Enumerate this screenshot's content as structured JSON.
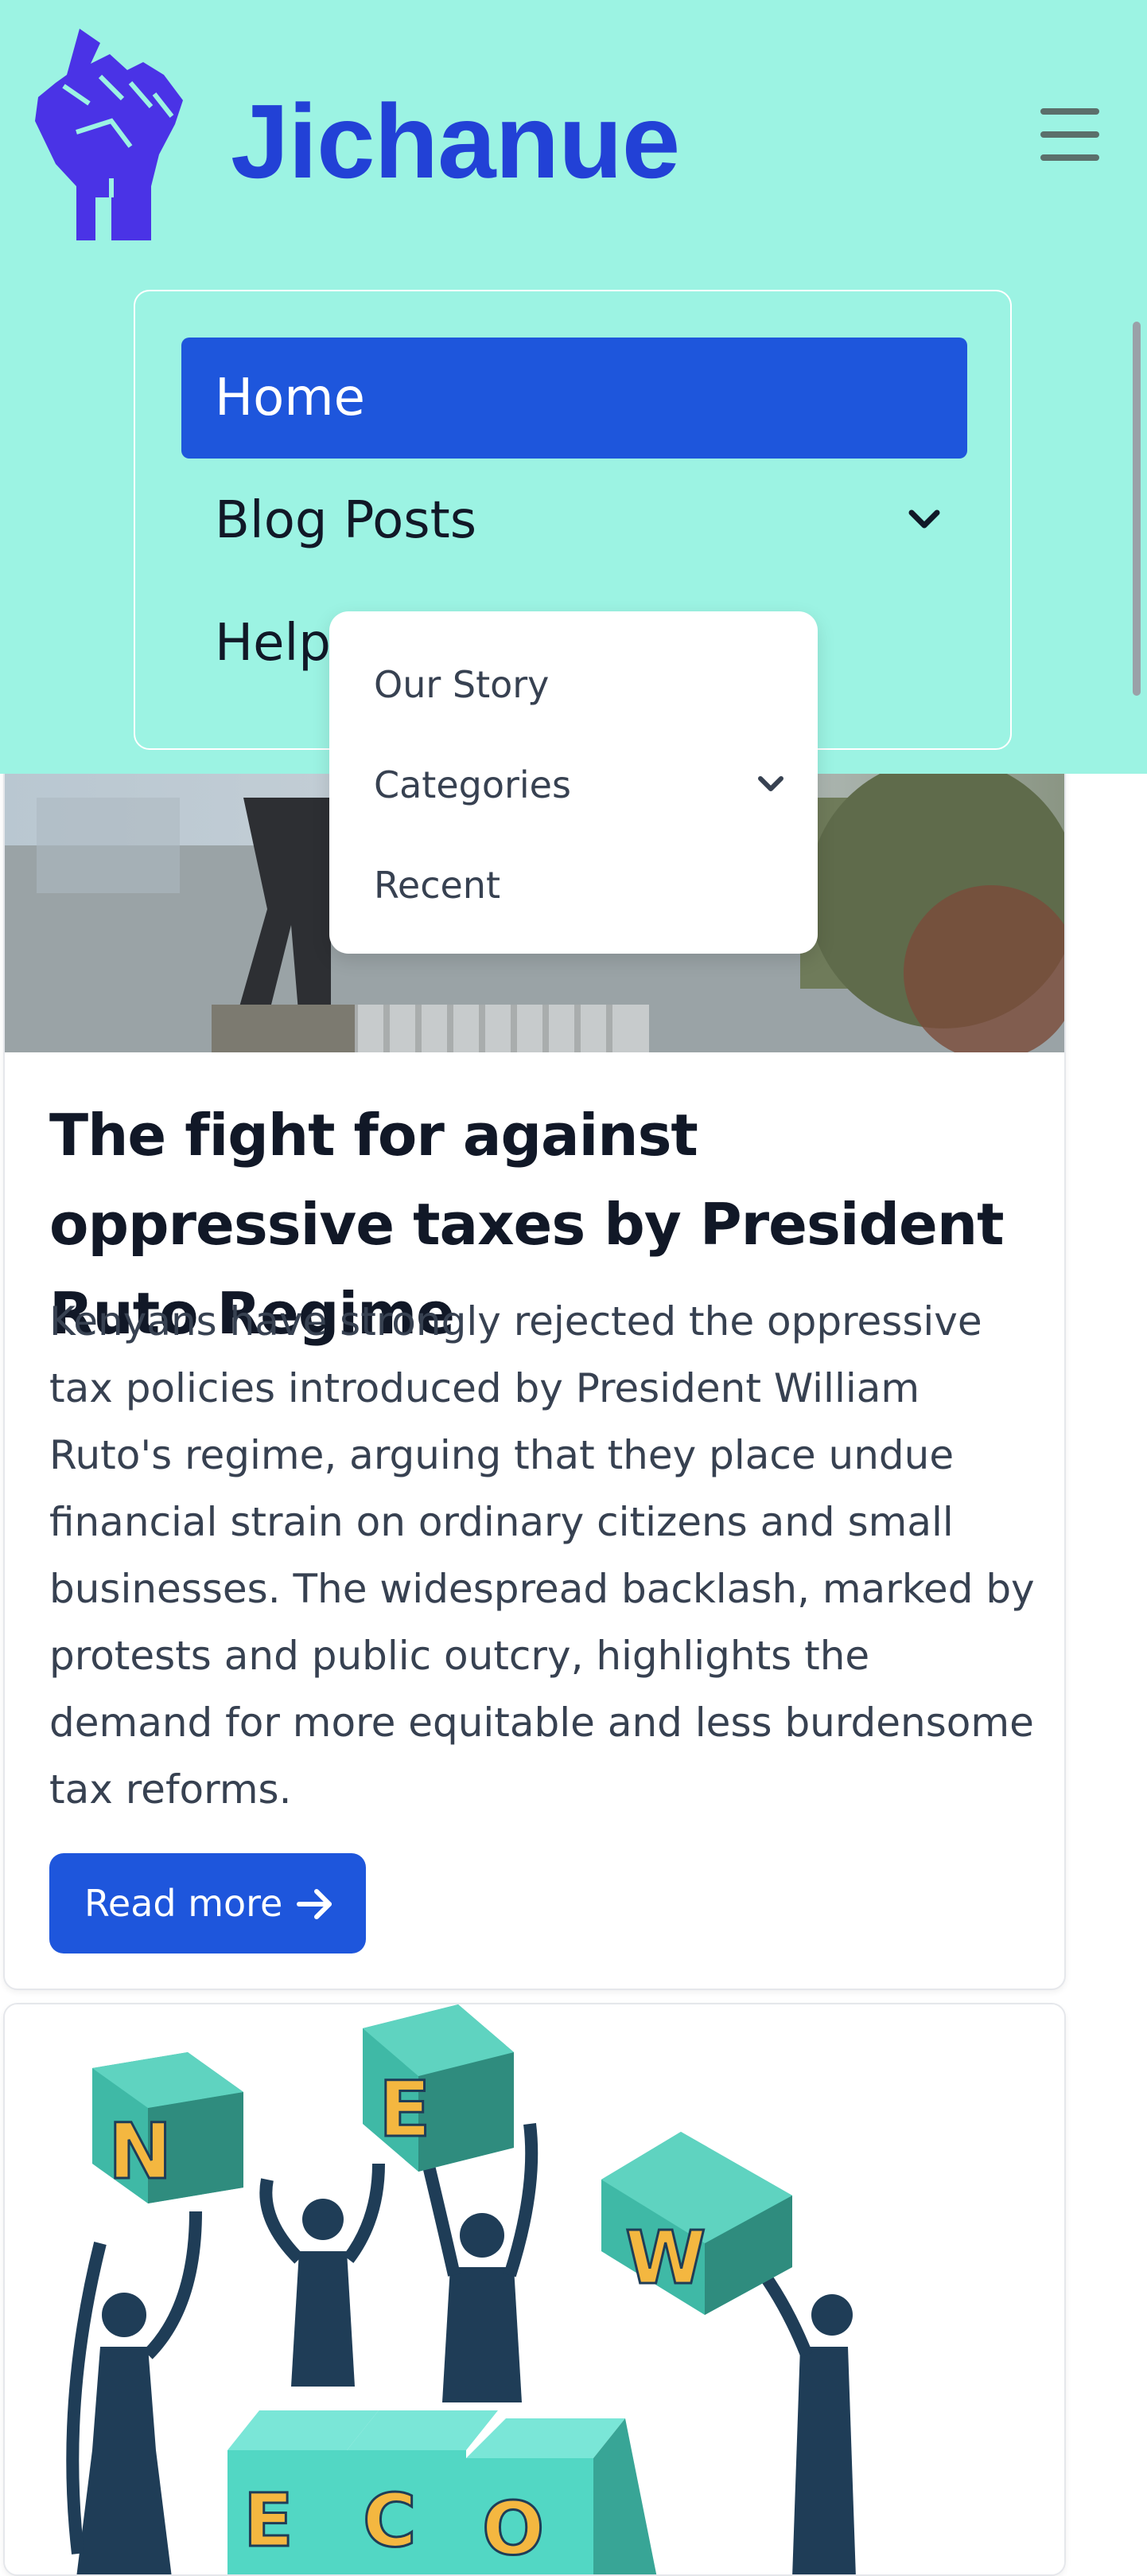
{
  "brand": {
    "name": "Jichanue",
    "logo_icon": "raised-fist-icon"
  },
  "nav": {
    "items": [
      {
        "label": "Home",
        "active": true
      },
      {
        "label": "Blog Posts",
        "has_dropdown": true
      },
      {
        "label": "Help"
      }
    ]
  },
  "dropdown": {
    "items": [
      {
        "label": "Our Story"
      },
      {
        "label": "Categories",
        "has_submenu": true
      },
      {
        "label": "Recent"
      }
    ]
  },
  "posts": [
    {
      "title": "The fight for against oppressive taxes by President Ruto Regime",
      "excerpt": "Kenyans have strongly rejected the oppressive tax policies introduced by President William Ruto's regime, arguing that they place undue financial strain on ordinary citizens and small businesses. The widespread backlash, marked by protests and public outcry, highlights the demand for more equitable and less burdensome tax reforms.",
      "button_label": "Read more"
    },
    {
      "image_letters_top": [
        "N",
        "E",
        "W"
      ],
      "image_letters_bottom": [
        "E",
        "C",
        "O"
      ]
    }
  ],
  "colors": {
    "header_bg": "#9cf3e3",
    "brand_blue": "#2241d6",
    "accent": "#1e56dc",
    "title": "#111827",
    "text": "#374151"
  }
}
